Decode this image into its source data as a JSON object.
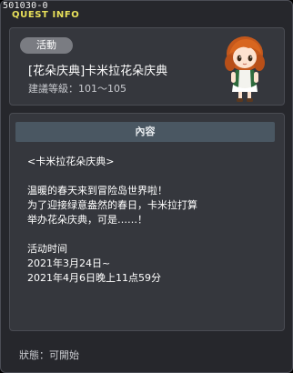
{
  "window": {
    "quest_id": "501030-0",
    "title": "QUEST INFO"
  },
  "header": {
    "badge": "活動",
    "quest_title": "[花朵庆典]卡米拉花朵庆典",
    "level_req": "建議等級：101～105"
  },
  "content": {
    "header": "內容",
    "lines": [
      "<卡米拉花朵庆典>",
      "",
      "温暖的春天来到冒险岛世界啦！",
      "为了迎接绿意盎然的春日，卡米拉打算",
      "举办花朵庆典，可是……！",
      "",
      "活动时间",
      "2021年3月24日~",
      "2021年4月6日晚上11点59分"
    ]
  },
  "status": {
    "text": "狀態：可開始"
  },
  "icons": {
    "npc": "camilla-npc-icon"
  }
}
